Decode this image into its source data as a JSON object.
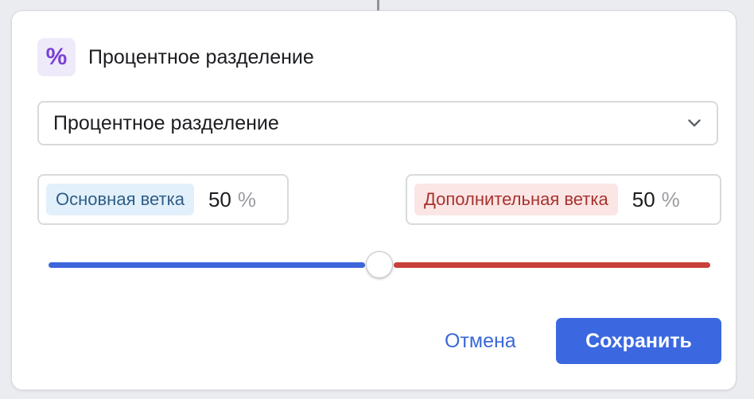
{
  "header": {
    "icon": "percent-icon",
    "icon_glyph": "%",
    "title": "Процентное разделение"
  },
  "split_select": {
    "selected": "Процентное разделение"
  },
  "branches": {
    "main": {
      "label": "Основная ветка",
      "percent": "50",
      "unit": "%"
    },
    "extra": {
      "label": "Дополнительная ветка",
      "percent": "50",
      "unit": "%"
    }
  },
  "slider": {
    "value_percent": 50,
    "left_color": "#3d66db",
    "right_color": "#c9403a"
  },
  "actions": {
    "cancel_label": "Отмена",
    "save_label": "Сохранить"
  },
  "colors": {
    "accent": "#3b68e0",
    "icon_accent": "#7b3fd6"
  }
}
